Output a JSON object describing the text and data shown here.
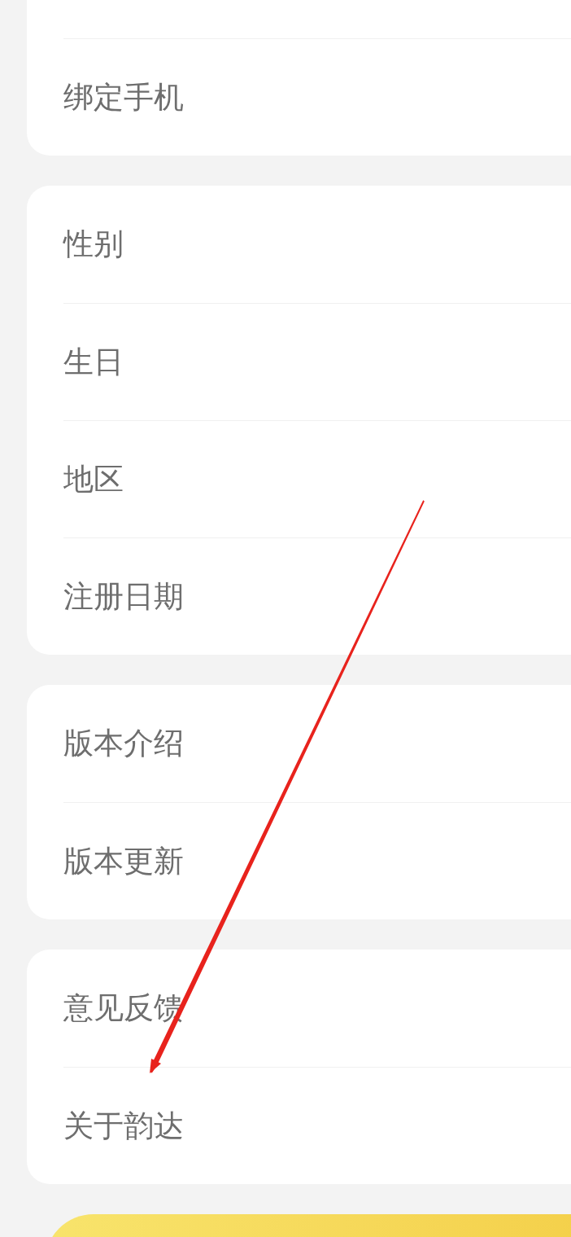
{
  "groups": [
    {
      "items": [
        {
          "label": "绑定手机"
        }
      ]
    },
    {
      "items": [
        {
          "label": "性别"
        },
        {
          "label": "生日"
        },
        {
          "label": "地区"
        },
        {
          "label": "注册日期"
        }
      ]
    },
    {
      "items": [
        {
          "label": "版本介绍"
        },
        {
          "label": "版本更新"
        }
      ]
    },
    {
      "items": [
        {
          "label": "意见反馈"
        },
        {
          "label": "关于韵达"
        }
      ]
    }
  ]
}
